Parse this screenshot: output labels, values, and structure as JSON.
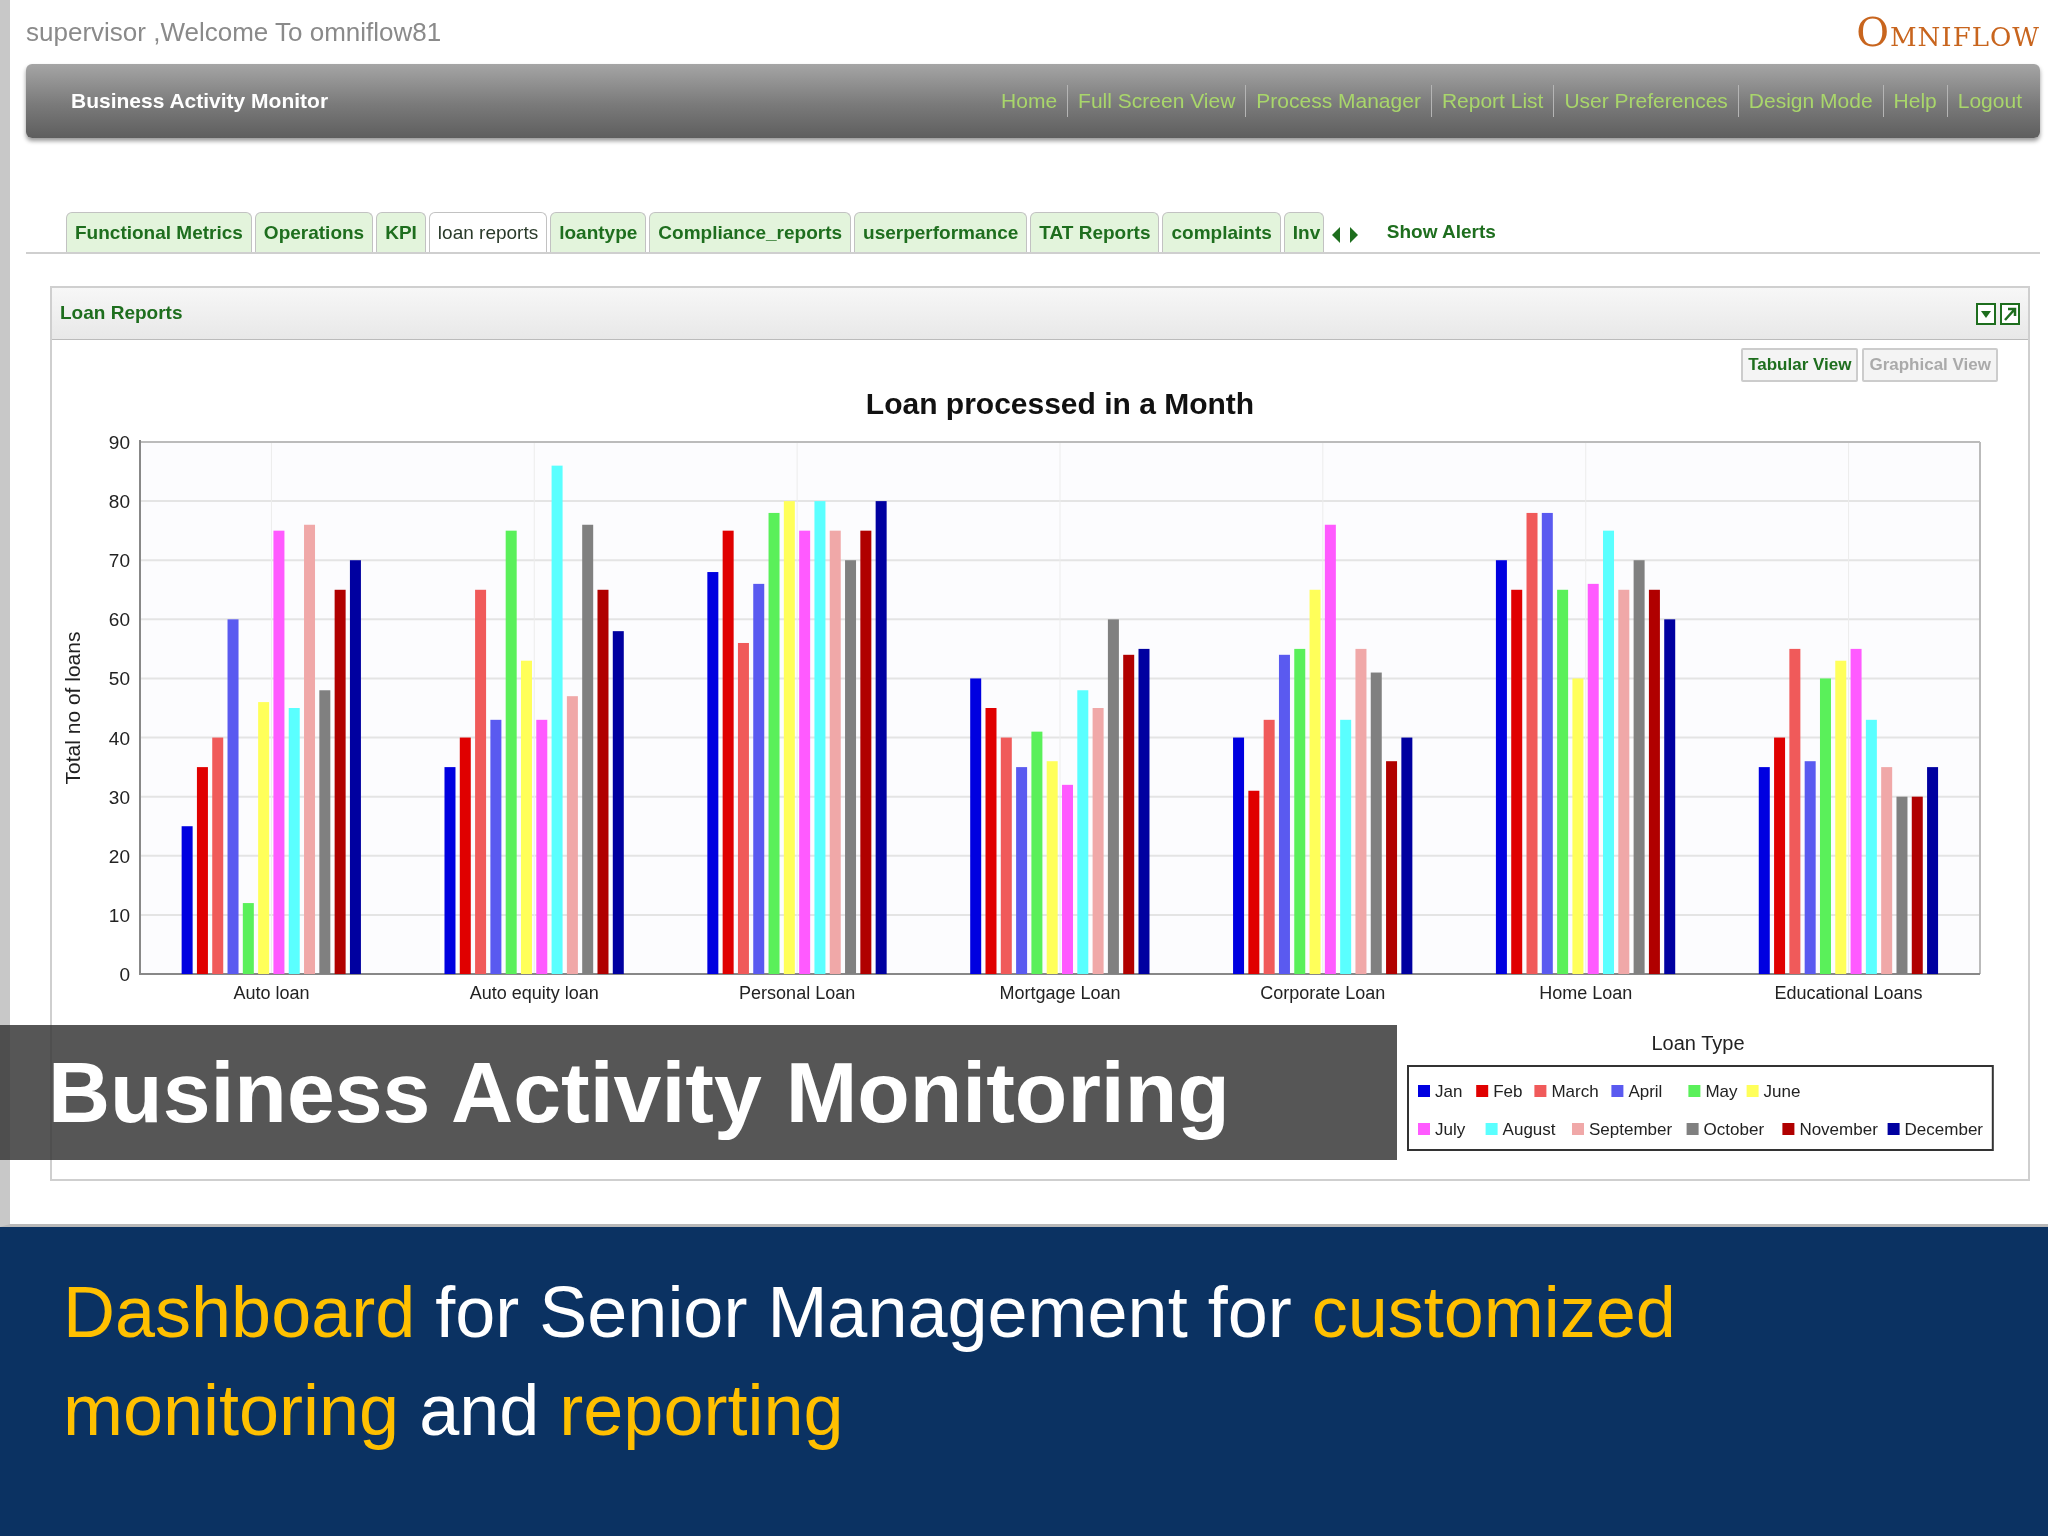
{
  "app": {
    "welcome": "supervisor ,Welcome To omniflow81",
    "logo": "OMNIFLOW"
  },
  "header": {
    "title": "Business Activity Monitor",
    "links": [
      "Home",
      "Full Screen View",
      "Process Manager",
      "Report List",
      "User Preferences",
      "Design Mode",
      "Help",
      "Logout"
    ]
  },
  "tabs": [
    {
      "label": "Functional Metrics",
      "selected": false
    },
    {
      "label": "Operations",
      "selected": false
    },
    {
      "label": "KPI",
      "selected": false
    },
    {
      "label": "loan reports",
      "selected": true
    },
    {
      "label": "loantype",
      "selected": false
    },
    {
      "label": "Compliance_reports",
      "selected": false
    },
    {
      "label": "userperformance",
      "selected": false
    },
    {
      "label": "TAT Reports",
      "selected": false
    },
    {
      "label": "complaints",
      "selected": false
    },
    {
      "label": "Inv",
      "selected": false
    }
  ],
  "show_alerts": "Show Alerts",
  "panel": {
    "title": "Loan Reports",
    "views": [
      {
        "label": "Tabular View",
        "disabled": false
      },
      {
        "label": "Graphical View",
        "disabled": true
      }
    ],
    "chart_data": {
      "type": "bar",
      "title": "Loan processed in a Month",
      "xlabel": "Loan Type",
      "ylabel": "Total no of loans",
      "categories": [
        "Auto loan",
        "Auto equity loan",
        "Personal Loan",
        "Mortgage Loan",
        "Corporate Loan",
        "Home Loan",
        "Educational Loans"
      ],
      "series": [
        {
          "name": "Jan",
          "color": "#0000e0",
          "values": [
            25,
            35,
            68,
            50,
            40,
            70,
            35
          ]
        },
        {
          "name": "Feb",
          "color": "#e00000",
          "values": [
            35,
            40,
            75,
            45,
            31,
            65,
            40
          ]
        },
        {
          "name": "March",
          "color": "#f05a5a",
          "values": [
            40,
            65,
            56,
            40,
            43,
            78,
            55
          ]
        },
        {
          "name": "April",
          "color": "#5a5af0",
          "values": [
            60,
            43,
            66,
            35,
            54,
            78,
            36
          ]
        },
        {
          "name": "May",
          "color": "#5af05a",
          "values": [
            12,
            75,
            78,
            41,
            55,
            65,
            50
          ]
        },
        {
          "name": "June",
          "color": "#ffff5a",
          "values": [
            46,
            53,
            80,
            36,
            65,
            50,
            53
          ]
        },
        {
          "name": "July",
          "color": "#ff5aff",
          "values": [
            75,
            43,
            75,
            32,
            76,
            66,
            55
          ]
        },
        {
          "name": "August",
          "color": "#5affff",
          "values": [
            45,
            86,
            80,
            48,
            43,
            75,
            43
          ]
        },
        {
          "name": "September",
          "color": "#f0a8a8",
          "values": [
            76,
            47,
            75,
            45,
            55,
            65,
            35
          ]
        },
        {
          "name": "October",
          "color": "#808080",
          "values": [
            48,
            76,
            70,
            60,
            51,
            70,
            30
          ]
        },
        {
          "name": "November",
          "color": "#b00000",
          "values": [
            65,
            65,
            75,
            54,
            36,
            65,
            30
          ]
        },
        {
          "name": "December",
          "color": "#0000a0",
          "values": [
            70,
            58,
            80,
            55,
            40,
            60,
            35
          ]
        }
      ],
      "grid": true,
      "legend": true,
      "ylim": [
        0,
        90
      ],
      "yticks": [
        0,
        10,
        20,
        30,
        40,
        50,
        60,
        70,
        80,
        90
      ]
    }
  },
  "slide_title": "Business Activity Monitoring",
  "caption": [
    {
      "text": "Dashboard",
      "highlight": true
    },
    {
      "text": " for Senior Management for ",
      "highlight": false
    },
    {
      "text": "customized",
      "highlight": true
    },
    {
      "text": " monitoring",
      "highlight": true
    },
    {
      "text": " and ",
      "highlight": false
    },
    {
      "text": "reporting",
      "highlight": true
    }
  ]
}
